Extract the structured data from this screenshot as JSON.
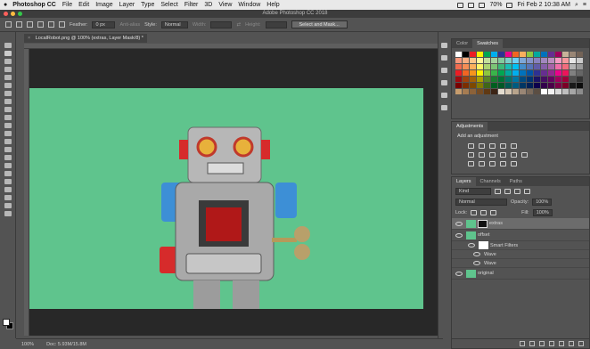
{
  "menubar": {
    "app_name": "Photoshop CC",
    "items": [
      "File",
      "Edit",
      "Image",
      "Layer",
      "Type",
      "Select",
      "Filter",
      "3D",
      "View",
      "Window",
      "Help"
    ],
    "battery": "70%",
    "datetime": "Fri Feb 2  10:38 AM"
  },
  "window": {
    "title": "Adobe Photoshop CC 2018"
  },
  "options_bar": {
    "feather_label": "Feather:",
    "feather_value": "0 px",
    "antialias_label": "Anti-alias",
    "style_label": "Style:",
    "style_value": "Normal",
    "width_label": "Width:",
    "height_label": "Height:",
    "select_mask_button": "Select and Mask..."
  },
  "document": {
    "tab_title": "LocalRobot.png @ 100% (extras, Layer Mask/8) *",
    "tab_close": "×",
    "zoom": "100%",
    "doc_info": "Doc: 5.93M/15.8M"
  },
  "swatches_panel": {
    "tabs": [
      "Color",
      "Swatches"
    ],
    "active_tab": "Swatches",
    "colors": [
      "#ffffff",
      "#000000",
      "#ed1c24",
      "#fff200",
      "#00a651",
      "#00aeef",
      "#2e3192",
      "#ec008c",
      "#f26522",
      "#fbaf5d",
      "#8dc63f",
      "#00a99d",
      "#0072bc",
      "#662d91",
      "#9e005d",
      "#c7b299",
      "#998675",
      "#736357",
      "#f7977a",
      "#f9ad81",
      "#fdc68a",
      "#fff79a",
      "#c4df9b",
      "#a3d39c",
      "#82ca9d",
      "#7bcdc8",
      "#6ecff6",
      "#7ea7d8",
      "#8493ca",
      "#8882be",
      "#a187be",
      "#bc8dbf",
      "#f49ac2",
      "#f6989d",
      "#e6e6e6",
      "#cccccc",
      "#f26c4f",
      "#f68e55",
      "#fbaf5c",
      "#fff467",
      "#acd372",
      "#7cc576",
      "#3bb878",
      "#1abbb4",
      "#00bff3",
      "#438ccb",
      "#5574b9",
      "#605ca8",
      "#855fa8",
      "#a763a8",
      "#f06ea9",
      "#f26d7d",
      "#b3b3b3",
      "#999999",
      "#ed1c24",
      "#f26522",
      "#f7941d",
      "#fff200",
      "#8dc63f",
      "#39b54a",
      "#00a651",
      "#00a99d",
      "#00aeef",
      "#0072bc",
      "#0054a6",
      "#2e3192",
      "#662d91",
      "#92278f",
      "#ec008c",
      "#ed145b",
      "#808080",
      "#666666",
      "#9e0b0f",
      "#a0410d",
      "#a36209",
      "#aba000",
      "#598527",
      "#1a7b30",
      "#007236",
      "#00746b",
      "#0076a3",
      "#004b80",
      "#003471",
      "#1b1464",
      "#440e62",
      "#630460",
      "#9e005d",
      "#9e0039",
      "#4d4d4d",
      "#333333",
      "#790000",
      "#7b2e00",
      "#7d4900",
      "#827b00",
      "#406618",
      "#005e20",
      "#005826",
      "#005952",
      "#005b7f",
      "#003663",
      "#002157",
      "#0d004c",
      "#32004b",
      "#4b0049",
      "#7b0046",
      "#7a0026",
      "#1a1a1a",
      "#0d0d0d",
      "#c69c6d",
      "#a67c52",
      "#8c6239",
      "#754c24",
      "#603913",
      "#3c2415",
      "#e4dccf",
      "#d6c7b4",
      "#b8a48c",
      "#998675",
      "#7a6a5b",
      "#5b4e43",
      "#ffffff",
      "#f2f2f2",
      "#d9d9d9",
      "#bfbfbf",
      "#a6a6a6",
      "#8c8c8c"
    ]
  },
  "adjustments_panel": {
    "title": "Adjustments",
    "subtitle": "Add an adjustment"
  },
  "layers_panel": {
    "tabs": [
      "Layers",
      "Channels",
      "Paths"
    ],
    "active_tab": "Layers",
    "filter_kind": "Kind",
    "blend_mode": "Normal",
    "opacity_label": "Opacity:",
    "opacity_value": "100%",
    "lock_label": "Lock:",
    "fill_label": "Fill:",
    "fill_value": "100%",
    "layers": [
      {
        "name": "extras",
        "selected": true
      },
      {
        "name": "offset",
        "selected": false
      },
      {
        "name": "Smart Filters",
        "selected": false
      },
      {
        "name": "Wave",
        "selected": false
      },
      {
        "name": "Wave",
        "selected": false
      },
      {
        "name": "original",
        "selected": false
      }
    ]
  },
  "colors": {
    "canvas_green": "#5fc48d",
    "ui_panel": "#535353",
    "ui_dark": "#282828"
  }
}
